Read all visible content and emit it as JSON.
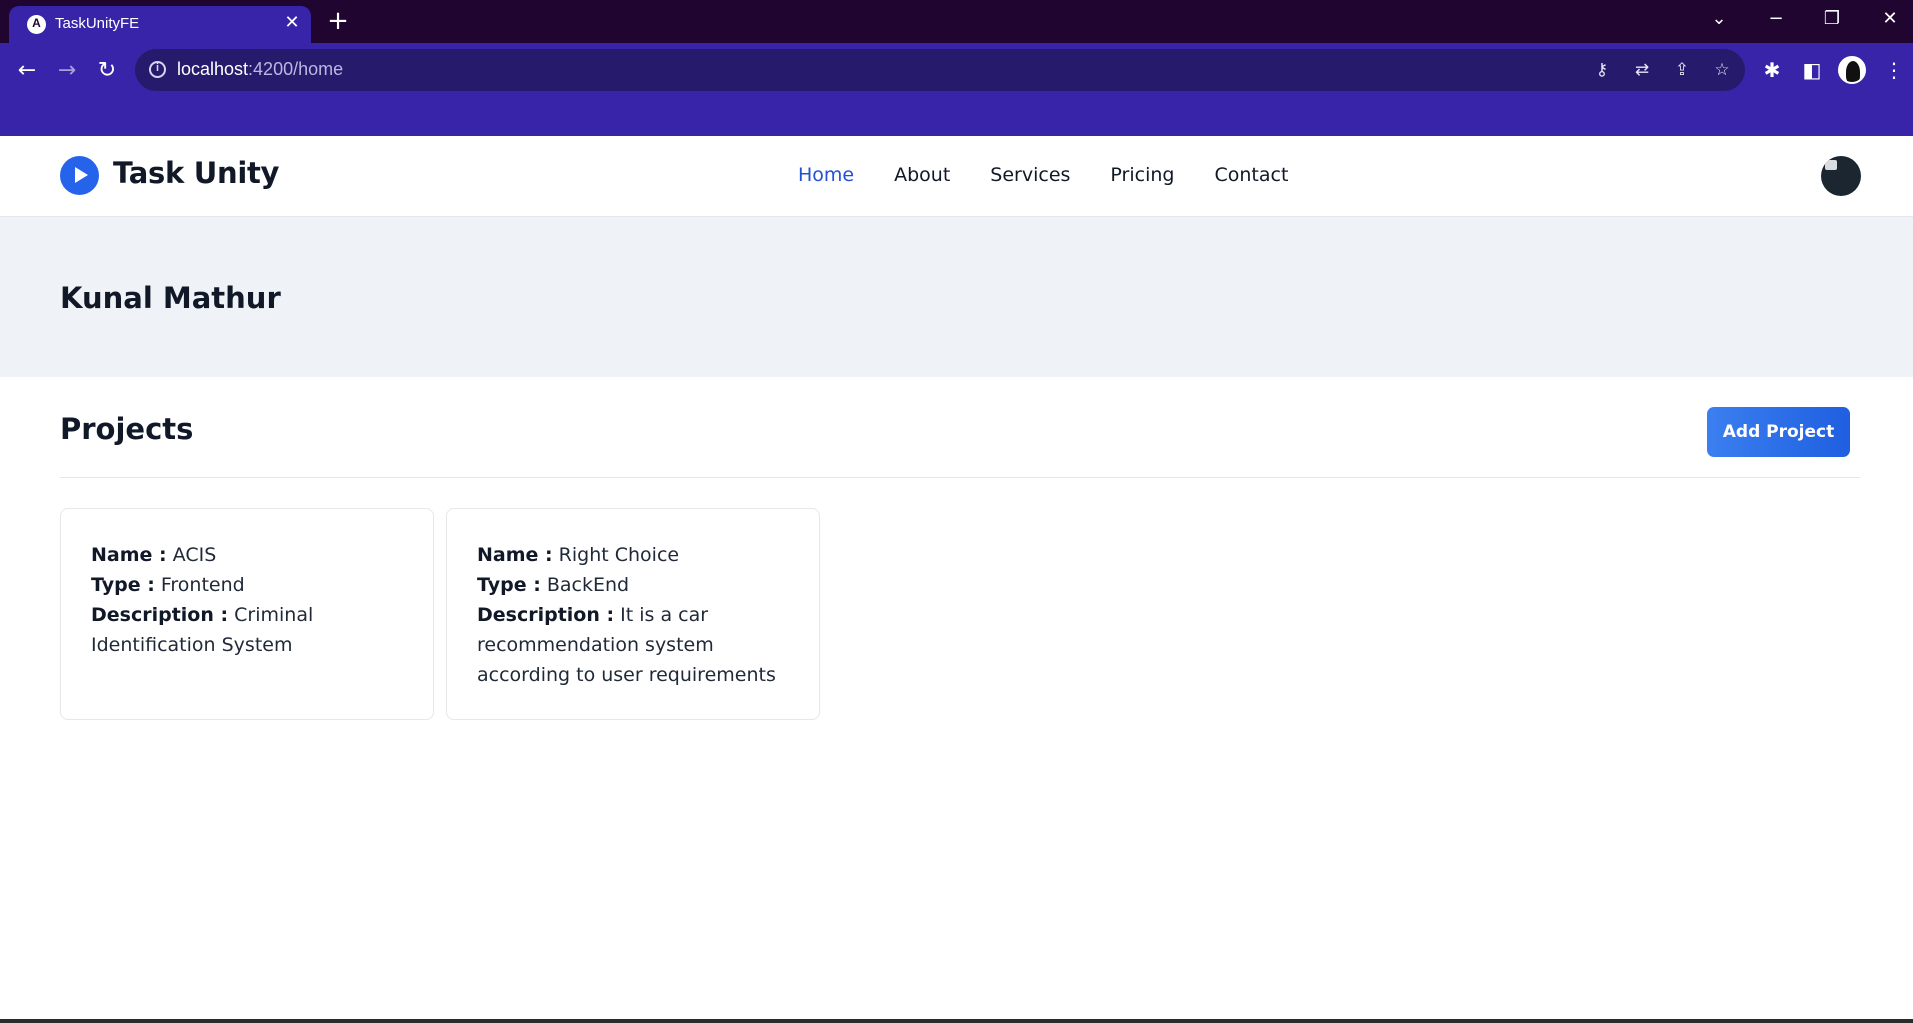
{
  "browser": {
    "tab_title": "TaskUnityFE",
    "tab_favicon": "A",
    "url_host": "localhost",
    "url_path": ":4200/home",
    "icons": {
      "back": "back-arrow-icon",
      "forward": "forward-arrow-icon",
      "reload": "reload-icon",
      "info": "site-info-icon",
      "key": "key-icon",
      "translate": "translate-icon",
      "share": "share-icon",
      "star": "bookmark-star-icon",
      "extensions": "puzzle-icon",
      "sidepanel": "side-panel-icon"
    }
  },
  "header": {
    "brand": "Task Unity",
    "nav": [
      {
        "label": "Home",
        "active": true
      },
      {
        "label": "About",
        "active": false
      },
      {
        "label": "Services",
        "active": false
      },
      {
        "label": "Pricing",
        "active": false
      },
      {
        "label": "Contact",
        "active": false
      }
    ]
  },
  "banner": {
    "user_name": "Kunal Mathur"
  },
  "projects": {
    "title": "Projects",
    "add_label": "Add Project",
    "field_labels": {
      "name": "Name :",
      "type": "Type :",
      "description": "Description :"
    },
    "items": [
      {
        "name": "ACIS",
        "type": "Frontend",
        "description": "Criminal Identification System"
      },
      {
        "name": "Right Choice",
        "type": "BackEnd",
        "description": "It is a car recommendation system according to user requirements"
      }
    ]
  },
  "colors": {
    "chrome_dark": "#1f0530",
    "chrome_accent": "#3824a8",
    "active_nav": "#2450d6",
    "button": "#2563eb",
    "banner_bg": "#eff3f8"
  }
}
